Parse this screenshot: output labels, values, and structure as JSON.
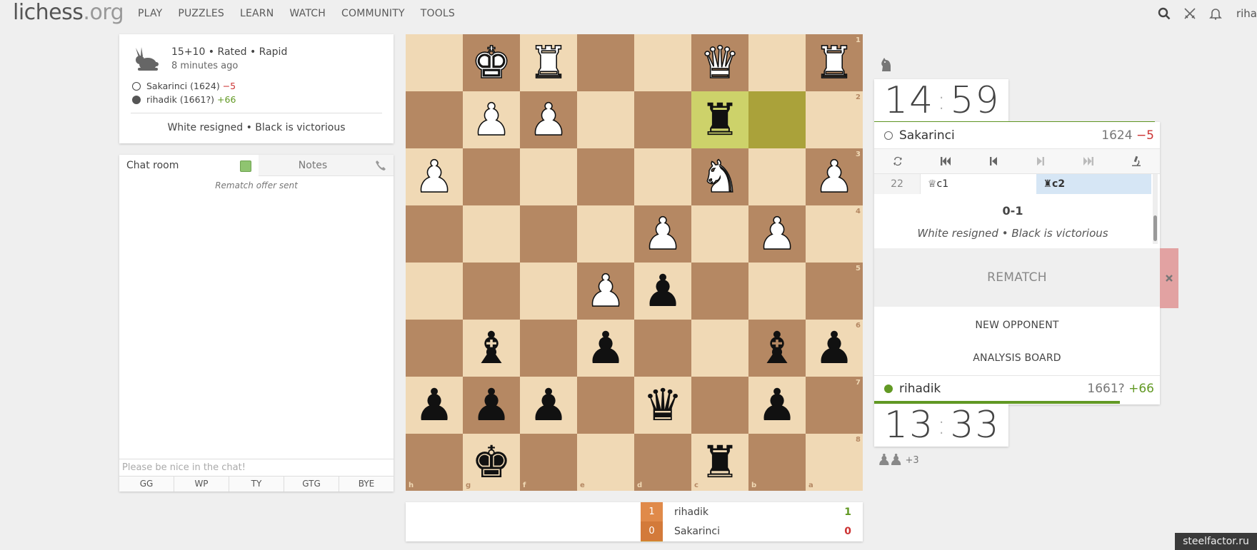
{
  "header": {
    "logo_main": "lichess",
    "logo_tld": ".org",
    "nav": [
      "PLAY",
      "PUZZLES",
      "LEARN",
      "WATCH",
      "COMMUNITY",
      "TOOLS"
    ],
    "user": "riha",
    "icons": [
      "search-icon",
      "swords-icon",
      "bell-icon"
    ]
  },
  "game_info": {
    "title": "15+10 • Rated • Rapid",
    "time_ago": "8 minutes ago",
    "players": [
      {
        "name": "Sakarinci (1624)",
        "diff": "−5",
        "color": "white"
      },
      {
        "name": "rihadik (1661?)",
        "diff": "+66",
        "color": "black"
      }
    ],
    "result": "White resigned • Black is victorious"
  },
  "chat": {
    "tab_chat": "Chat room",
    "tab_notes": "Notes",
    "system_message": "Rematch offer sent",
    "input_placeholder": "Please be nice in the chat!",
    "presets": [
      "GG",
      "WP",
      "TY",
      "GTG",
      "BYE"
    ]
  },
  "board": {
    "orientation": "black",
    "ranks": [
      "1",
      "2",
      "3",
      "4",
      "5",
      "6",
      "7",
      "8"
    ],
    "files": [
      "h",
      "g",
      "f",
      "e",
      "d",
      "c",
      "b",
      "a"
    ],
    "rows": [
      [
        "",
        "wK",
        "wR",
        "",
        "",
        "wQ",
        "",
        "wR"
      ],
      [
        "",
        "wP",
        "wP",
        "",
        "",
        "bR",
        "",
        ""
      ],
      [
        "wP",
        "",
        "",
        "",
        "",
        "wN",
        "",
        "wP"
      ],
      [
        "",
        "",
        "",
        "",
        "wP",
        "",
        "wP",
        ""
      ],
      [
        "",
        "",
        "",
        "wP",
        "bP",
        "",
        "",
        ""
      ],
      [
        "",
        "bB",
        "",
        "bP",
        "",
        "",
        "bB",
        "bP"
      ],
      [
        "bP",
        "bP",
        "bP",
        "",
        "bQ",
        "",
        "bP",
        ""
      ],
      [
        "",
        "bK",
        "",
        "",
        "",
        "bR",
        "",
        ""
      ]
    ],
    "highlights": [
      [
        1,
        5
      ],
      [
        1,
        6
      ]
    ]
  },
  "crosstable": {
    "rows": [
      {
        "name": "rihadik",
        "score": "1",
        "total": "1",
        "result": "win"
      },
      {
        "name": "Sakarinci",
        "score": "0",
        "total": "0",
        "result": "loss"
      }
    ]
  },
  "right_panel": {
    "top_clock": {
      "min": "14",
      "sec": "59"
    },
    "bottom_clock": {
      "min": "13",
      "sec": "33"
    },
    "top_player": {
      "name": "Sakarinci",
      "rating": "1624",
      "diff": "−5"
    },
    "bottom_player": {
      "name": "rihadik",
      "rating": "1661?",
      "diff": "+66"
    },
    "move_number": "22",
    "white_move": "♕c1",
    "black_move": "♜c2",
    "score": "0-1",
    "result_text": "White resigned • Black is victorious",
    "rematch": "REMATCH",
    "new_opponent": "NEW OPPONENT",
    "analysis_board": "ANALYSIS BOARD",
    "material_extra": "+3"
  },
  "watermark": "steelfactor.ru",
  "colors": {
    "board_light": "#f0d9b5",
    "board_dark": "#b58863",
    "highlight": "#cdd26a",
    "positive": "#629924",
    "negative": "#cc3333"
  }
}
